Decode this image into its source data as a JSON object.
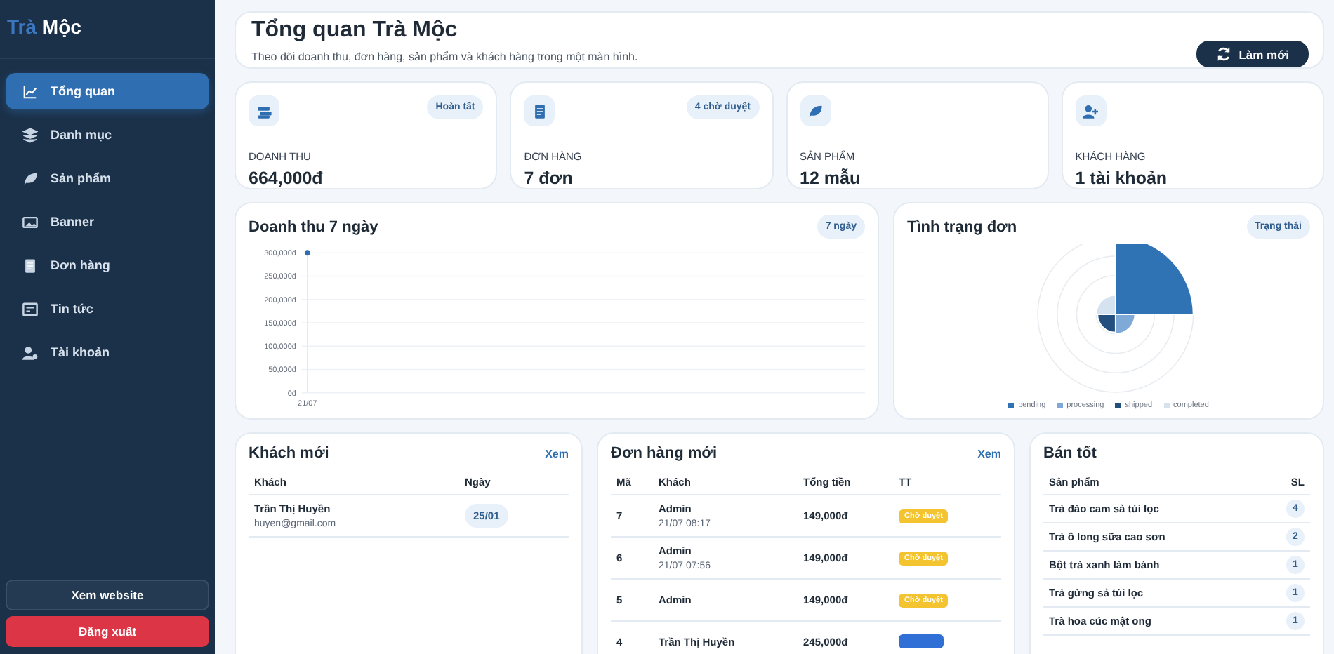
{
  "sidebar": {
    "brand": {
      "accent": "Trà",
      "name": "Mộc"
    },
    "items": [
      {
        "label": "Tổng quan",
        "selected": true
      },
      {
        "label": "Danh mục",
        "selected": false
      },
      {
        "label": "Sản phẩm",
        "selected": false
      },
      {
        "label": "Banner",
        "selected": false
      },
      {
        "label": "Đơn hàng",
        "selected": false
      },
      {
        "label": "Tin tức",
        "selected": false
      },
      {
        "label": "Tài khoản",
        "selected": false
      }
    ],
    "buttons": [
      {
        "label": "Xem website",
        "kind": "secondary"
      },
      {
        "label": "Đăng xuất",
        "kind": "danger"
      }
    ]
  },
  "header": {
    "title": "Tổng quan Trà Mộc",
    "subtitle": "Theo dõi doanh thu, đơn hàng, sản phẩm và khách hàng trong một màn hình.",
    "button": "Làm mới"
  },
  "stats": [
    {
      "badge": "Hoàn tất",
      "label": "DOANH THU",
      "value": "664,000đ"
    },
    {
      "badge": "4 chờ duyệt",
      "label": "ĐƠN HÀNG",
      "value": "7 đơn"
    },
    {
      "label": "SẢN PHẨM",
      "value": "12 mẫu"
    },
    {
      "label": "KHÁCH HÀNG",
      "value": "1 tài khoản"
    }
  ],
  "revenue": {
    "title": "Doanh thu 7 ngày",
    "badge": "7 ngày",
    "chart_data": {
      "type": "line",
      "grid": true,
      "categories": [
        "21/07"
      ],
      "series": [
        {
          "color": "#2f6eb0",
          "marker": true,
          "values": [
            300000
          ]
        }
      ],
      "ylim": [
        0,
        300000
      ],
      "yticks": [
        {
          "value": 0,
          "label": "0đ"
        },
        {
          "value": 50000,
          "label": "50,000đ"
        },
        {
          "value": 100000,
          "label": "100,000đ"
        },
        {
          "value": 150000,
          "label": "150,000đ"
        },
        {
          "value": 200000,
          "label": "200,000đ"
        },
        {
          "value": 250000,
          "label": "250,000đ"
        },
        {
          "value": 300000,
          "label": "300,000đ"
        }
      ]
    }
  },
  "status": {
    "title": "Tình trạng đơn",
    "badge": "Trạng thái",
    "legend": [
      {
        "label": "pending",
        "color": "#2f73b5"
      },
      {
        "label": "processing",
        "color": "#7fa9d6"
      },
      {
        "label": "shipped",
        "color": "#234f7e"
      },
      {
        "label": "completed",
        "color": "#d5e3f1"
      }
    ]
  },
  "customers": {
    "title": "Khách mới",
    "link": "Xem",
    "columns": [
      "Khách",
      "Ngày"
    ],
    "rows": [
      {
        "name": "Trần Thị Huyền",
        "email": "huyen@gmail.com",
        "date": "25/01"
      }
    ]
  },
  "orders": {
    "title": "Đơn hàng mới",
    "link": "Xem",
    "columns": [
      "Mã",
      "Khách",
      "Tổng tiền",
      "TT"
    ],
    "rows": [
      {
        "id": "7",
        "customer": "Admin",
        "time": "21/07 08:17",
        "total": "149,000đ",
        "status": "Chờ duyệt",
        "color": "#f4c430"
      },
      {
        "id": "6",
        "customer": "Admin",
        "time": "21/07 07:56",
        "total": "149,000đ",
        "status": "Chờ duyệt",
        "color": "#f4c430"
      },
      {
        "id": "5",
        "customer": "Admin",
        "total": "149,000đ",
        "status": "Chờ duyệt",
        "color": "#f4c430"
      },
      {
        "id": "4",
        "customer": "Trần Thị Huyền",
        "total": "245,000đ",
        "color": "#2f6fd6"
      }
    ]
  },
  "bestsellers": {
    "title": "Bán tốt",
    "columns": [
      "Sản phẩm",
      "SL"
    ],
    "rows": [
      {
        "name": "Trà đào cam sả túi lọc",
        "qty": "4"
      },
      {
        "name": "Trà ô long sữa cao sơn",
        "qty": "2"
      },
      {
        "name": "Bột trà xanh làm bánh",
        "qty": "1"
      },
      {
        "name": "Trà gừng sả túi lọc",
        "qty": "1"
      },
      {
        "name": "Trà hoa cúc mật ong",
        "qty": "1"
      }
    ]
  }
}
